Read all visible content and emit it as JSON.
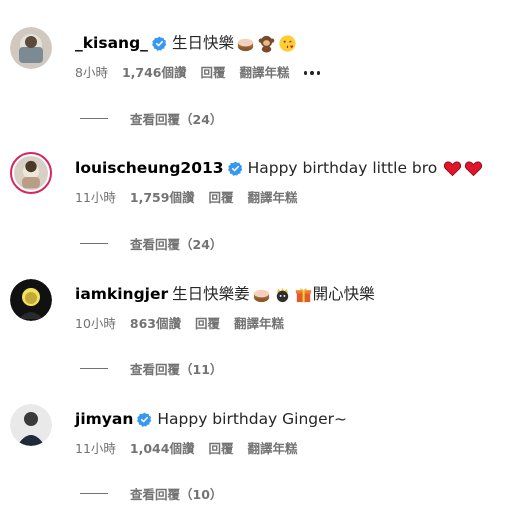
{
  "comments": [
    {
      "username": "_kisang_",
      "verified": true,
      "text": "生日快樂",
      "emojis": [
        "cake-icon",
        "monkey-icon",
        "kiss-face-icon"
      ],
      "time": "8小時",
      "likes": "1,746個讚",
      "reply_label": "回覆",
      "translate_label": "翻譯年糕",
      "has_more": true,
      "view_replies": "查看回覆（24）"
    },
    {
      "username": "louischeung2013",
      "verified": true,
      "text": "Happy birthday little bro",
      "emojis": [
        "red-heart-icon",
        "red-heart-icon"
      ],
      "time": "11小時",
      "likes": "1,759個讚",
      "reply_label": "回覆",
      "translate_label": "翻譯年糕",
      "has_more": false,
      "view_replies": "查看回覆（24）"
    },
    {
      "username": "iamkingjer",
      "verified": false,
      "text": "生日快樂姜",
      "emojis": [
        "cake-icon",
        "crown-face-icon",
        "gift-icon"
      ],
      "text_after": "開心快樂",
      "time": "10小時",
      "likes": "863個讚",
      "reply_label": "回覆",
      "translate_label": "翻譯年糕",
      "has_more": false,
      "view_replies": "查看回覆（11）"
    },
    {
      "username": "jimyan",
      "verified": true,
      "text": "Happy birthday Ginger~",
      "emojis": [],
      "time": "11小時",
      "likes": "1,044個讚",
      "reply_label": "回覆",
      "translate_label": "翻譯年糕",
      "has_more": false,
      "view_replies": "查看回覆（10）"
    }
  ],
  "colors": {
    "verified_blue": "#3897f0",
    "meta_gray": "#737373",
    "story_ring": "#d9245f",
    "heart_red": "#e0142a"
  }
}
